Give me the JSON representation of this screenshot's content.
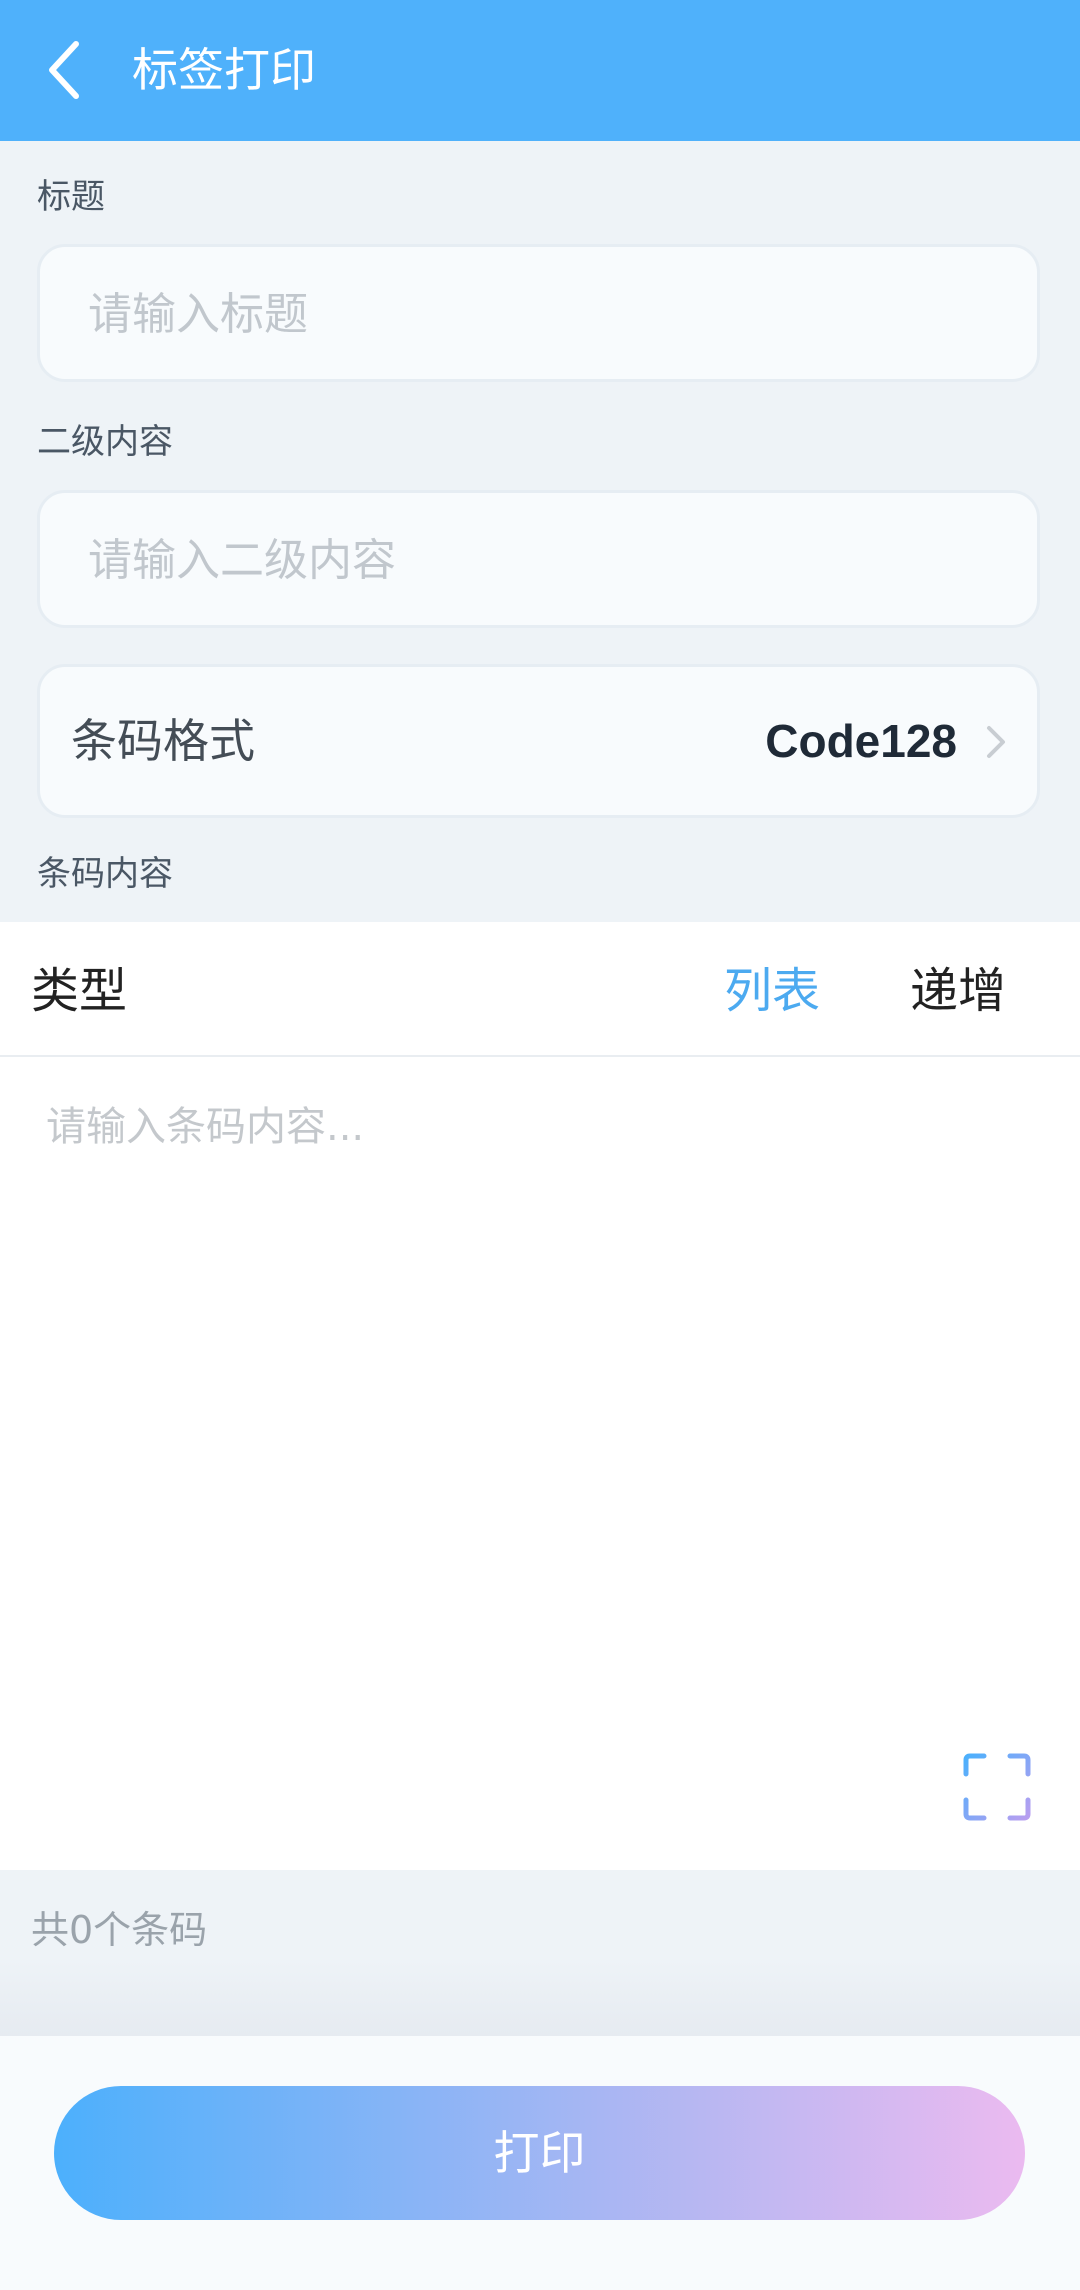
{
  "header": {
    "title": "标签打印"
  },
  "form": {
    "title_label": "标题",
    "title_placeholder": "请输入标题",
    "sub_label": "二级内容",
    "sub_placeholder": "请输入二级内容",
    "format_label": "条码格式",
    "format_value": "Code128",
    "content_label": "条码内容"
  },
  "editor": {
    "type_label": "类型",
    "tabs": [
      {
        "label": "列表",
        "active": true
      },
      {
        "label": "递增",
        "active": false
      }
    ],
    "placeholder": "请输入条码内容...",
    "count_text": "共0个条码"
  },
  "footer": {
    "print_label": "打印"
  },
  "colors": {
    "header": "#4fb1fb",
    "accent": "#4caaf0",
    "gradient_start": "#4cb0fc",
    "gradient_end": "#ebbaf0"
  },
  "icons": [
    "chevron-left-icon",
    "chevron-right-icon",
    "scan-icon"
  ]
}
